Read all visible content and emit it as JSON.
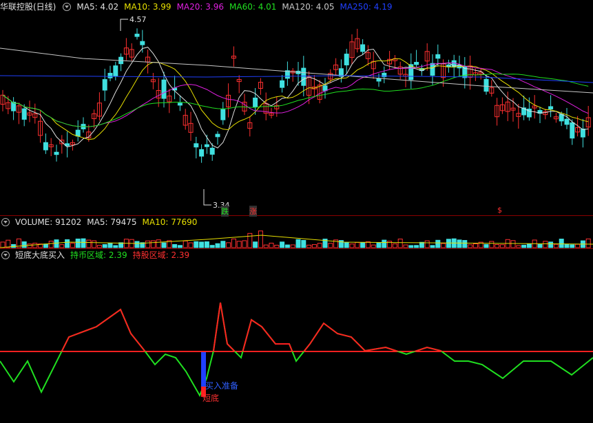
{
  "main": {
    "title": "华联控股(日线)",
    "ma_items": [
      {
        "label": "MA5: 4.02",
        "color": "#e0e0e0"
      },
      {
        "label": "MA10: 3.99",
        "color": "#e8e000"
      },
      {
        "label": "MA20: 3.96",
        "color": "#e020e0"
      },
      {
        "label": "MA60: 4.01",
        "color": "#20e020"
      },
      {
        "label": "MA120: 4.05",
        "color": "#c8c8c8"
      },
      {
        "label": "MA250: 4.19",
        "color": "#2040ff"
      }
    ],
    "high_label": "4.57",
    "low_label": "3.34",
    "marker_down": "跌",
    "marker_up": "涨",
    "marker_dollar": "$"
  },
  "volume": {
    "items": [
      {
        "label": "VOLUME: 91202",
        "color": "#e0e0e0"
      },
      {
        "label": "MA5: 79475",
        "color": "#e0e0e0"
      },
      {
        "label": "MA10: 77690",
        "color": "#e8e000"
      }
    ]
  },
  "indicator": {
    "title": "短底大底买入",
    "items": [
      {
        "label": "持币区域: 2.39",
        "color": "#20e020"
      },
      {
        "label": "持股区域: 2.39",
        "color": "#ff3030"
      }
    ],
    "label_buy_ready": "买入准备",
    "label_short_bottom": "短底"
  },
  "colors": {
    "up": "#ff3030",
    "down": "#40e0e0",
    "ma5": "#e0e0e0",
    "ma10": "#e8e000",
    "ma20": "#e020e0",
    "ma60": "#20e020",
    "ma120": "#c8c8c8",
    "ma250": "#2040ff",
    "ind_hold": "#ff2020",
    "ind_cash": "#20e020",
    "bar_blue": "#2040ff",
    "bar_red": "#ff2020"
  }
}
